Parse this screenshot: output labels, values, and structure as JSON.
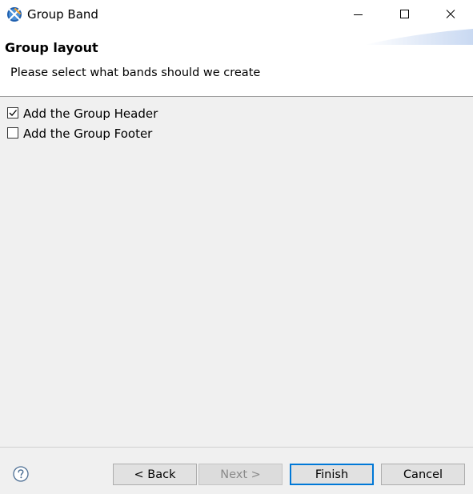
{
  "window": {
    "title": "Group Band"
  },
  "header": {
    "title": "Group layout",
    "description": "Please select what bands should we create"
  },
  "options": [
    {
      "label": "Add the Group Header",
      "checked": true
    },
    {
      "label": "Add the Group Footer",
      "checked": false
    }
  ],
  "footer": {
    "back_label": "< Back",
    "next_label": "Next >",
    "finish_label": "Finish",
    "cancel_label": "Cancel"
  },
  "colors": {
    "accent": "#0078d7",
    "banner_graphic": "#c9d9f2"
  }
}
